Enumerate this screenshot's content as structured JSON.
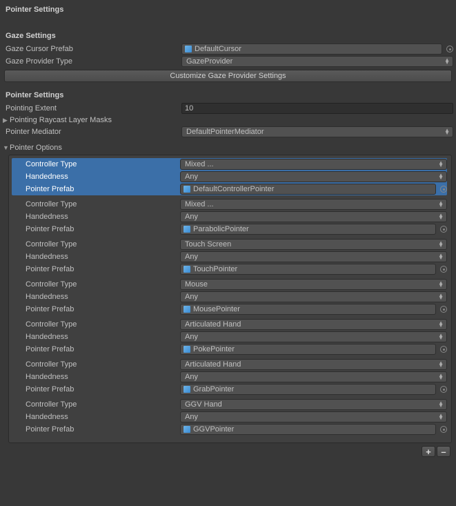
{
  "title": "Pointer Settings",
  "gaze": {
    "header": "Gaze Settings",
    "cursor_label": "Gaze Cursor Prefab",
    "cursor_value": "DefaultCursor",
    "provider_label": "Gaze Provider Type",
    "provider_value": "GazeProvider",
    "customize_label": "Customize Gaze Provider Settings"
  },
  "pointer": {
    "header": "Pointer Settings",
    "extent_label": "Pointing Extent",
    "extent_value": "10",
    "raycast_label": "Pointing Raycast Layer Masks",
    "mediator_label": "Pointer Mediator",
    "mediator_value": "DefaultPointerMediator",
    "options_label": "Pointer Options"
  },
  "labels": {
    "controller_type": "Controller Type",
    "handedness": "Handedness",
    "pointer_prefab": "Pointer Prefab"
  },
  "options": [
    {
      "controller": "Mixed ...",
      "handed": "Any",
      "prefab": "DefaultControllerPointer",
      "selected": true
    },
    {
      "controller": "Mixed ...",
      "handed": "Any",
      "prefab": "ParabolicPointer",
      "selected": false
    },
    {
      "controller": "Touch Screen",
      "handed": "Any",
      "prefab": "TouchPointer",
      "selected": false
    },
    {
      "controller": "Mouse",
      "handed": "Any",
      "prefab": "MousePointer",
      "selected": false
    },
    {
      "controller": "Articulated Hand",
      "handed": "Any",
      "prefab": "PokePointer",
      "selected": false
    },
    {
      "controller": "Articulated Hand",
      "handed": "Any",
      "prefab": "GrabPointer",
      "selected": false
    },
    {
      "controller": "GGV Hand",
      "handed": "Any",
      "prefab": "GGVPointer",
      "selected": false
    }
  ],
  "footer": {
    "plus": "+",
    "minus": "–"
  }
}
